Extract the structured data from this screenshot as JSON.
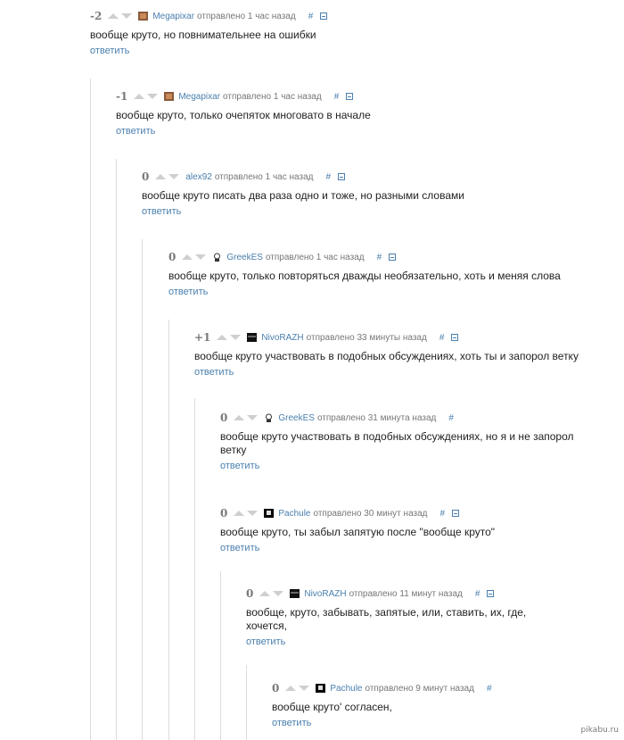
{
  "comments": [
    {
      "score": "-2",
      "author": "Megapixar",
      "posted": "отправлено 1 час назад",
      "hash": "#",
      "collapse": true,
      "avatar": "brown",
      "text": "вообще круто, но повнимательнее на ошибки",
      "reply": "ответить"
    },
    {
      "score": "-1",
      "author": "Megapixar",
      "posted": "отправлено 1 час назад",
      "hash": "#",
      "collapse": true,
      "avatar": "brown",
      "text": "вообще круто, только очепяток многовато в начале",
      "reply": "ответить"
    },
    {
      "score": "0",
      "author": "alex92",
      "posted": "отправлено 1 час назад",
      "hash": "#",
      "collapse": true,
      "avatar": "none",
      "text": "вообще круто писать два раза одно и тоже, но разными словами",
      "reply": "ответить"
    },
    {
      "score": "0",
      "author": "GreekES",
      "posted": "отправлено 1 час назад",
      "hash": "#",
      "collapse": true,
      "avatar": "sketch",
      "text": "вообще круто, только повторяться дважды необязательно, хоть и меняя слова",
      "reply": "ответить"
    },
    {
      "score": "+1",
      "author": "NivoRAZH",
      "posted": "отправлено 33 минуты назад",
      "hash": "#",
      "collapse": true,
      "avatar": "dark",
      "text": "вообще круто участвовать в подобных обсуждениях, хоть ты и запорол ветку",
      "reply": "ответить"
    },
    {
      "score": "0",
      "author": "GreekES",
      "posted": "отправлено 31 минута назад",
      "hash": "#",
      "collapse": false,
      "avatar": "sketch",
      "text": "вообще круто участвовать в подобных обсуждениях, но я и не запорол ветку",
      "reply": "ответить"
    },
    {
      "score": "0",
      "author": "Pachule",
      "posted": "отправлено 30 минут назад",
      "hash": "#",
      "collapse": true,
      "avatar": "bw",
      "text": "вообще круто, ты забыл запятую после \"вообще круто\"",
      "reply": "ответить"
    },
    {
      "score": "0",
      "author": "NivoRAZH",
      "posted": "отправлено 11 минут назад",
      "hash": "#",
      "collapse": true,
      "avatar": "dark",
      "text": "вообще, круто, забывать, запятые, или, ставить, их, где, хочется,",
      "reply": "ответить"
    },
    {
      "score": "0",
      "author": "Pachule",
      "posted": "отправлено 9 минут назад",
      "hash": "#",
      "collapse": false,
      "avatar": "bw",
      "text": "вообще круто' согласен,",
      "reply": "ответить"
    }
  ],
  "watermark": "pikabu.ru",
  "colors": {
    "link": "#4a7fae",
    "meta": "#777777",
    "score": "#7a7a7a",
    "thread_line": "#dcdcdc"
  }
}
